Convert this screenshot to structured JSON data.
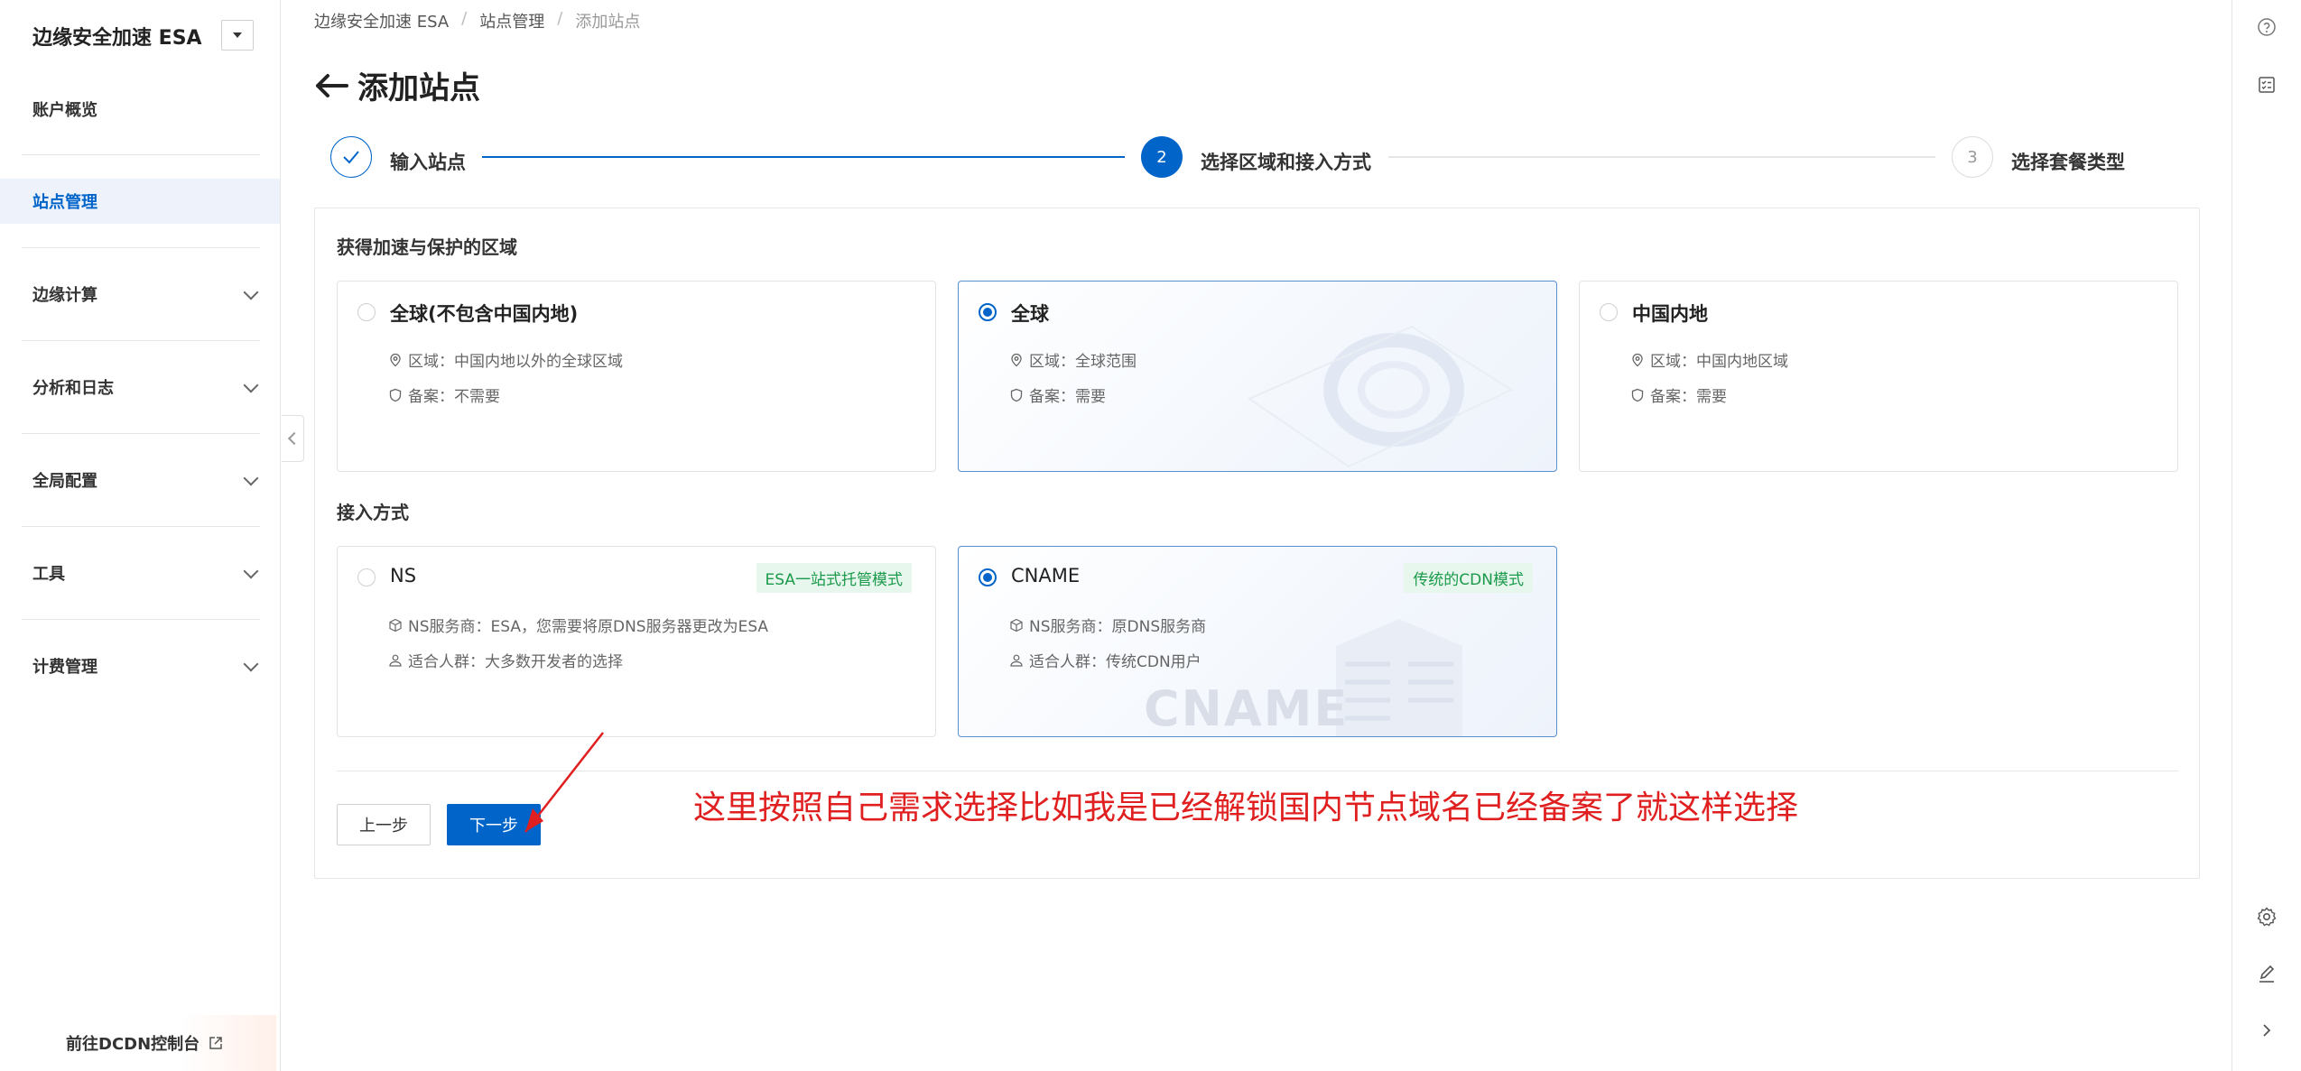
{
  "sidebar": {
    "brand": "边缘安全加速 ESA",
    "items": [
      {
        "label": "账户概览"
      },
      {
        "label": "站点管理"
      },
      {
        "label": "边缘计算"
      },
      {
        "label": "分析和日志"
      },
      {
        "label": "全局配置"
      },
      {
        "label": "工具"
      },
      {
        "label": "计费管理"
      }
    ],
    "footer_link": "前往DCDN控制台"
  },
  "breadcrumb": [
    "边缘安全加速 ESA",
    "站点管理",
    "添加站点"
  ],
  "page_title": "添加站点",
  "steps": [
    {
      "number": "",
      "label": "输入站点",
      "status": "done"
    },
    {
      "number": "2",
      "label": "选择区域和接入方式",
      "status": "active"
    },
    {
      "number": "3",
      "label": "选择套餐类型",
      "status": "pending"
    }
  ],
  "region": {
    "title": "获得加速与保护的区域",
    "options": [
      {
        "title": "全球(不包含中国内地)",
        "area": "区域：中国内地以外的全球区域",
        "icp": "备案：不需要"
      },
      {
        "title": "全球",
        "area": "区域：全球范围",
        "icp": "备案：需要"
      },
      {
        "title": "中国内地",
        "area": "区域：中国内地区域",
        "icp": "备案：需要"
      }
    ],
    "selected": 1
  },
  "access": {
    "title": "接入方式",
    "options": [
      {
        "title": "NS",
        "tag": "ESA一站式托管模式",
        "ns": "NS服务商：ESA，您需要将原DNS服务器更改为ESA",
        "audience": "适合人群：大多数开发者的选择"
      },
      {
        "title": "CNAME",
        "tag": "传统的CDN模式",
        "ns": "NS服务商：原DNS服务商",
        "audience": "适合人群：传统CDN用户",
        "watermark": "CNAME"
      }
    ],
    "selected": 1
  },
  "buttons": {
    "prev": "上一步",
    "next": "下一步"
  },
  "annotation": "这里按照自己需求选择比如我是已经解锁国内节点域名已经备案了就这样选择",
  "colors": {
    "primary": "#0064c8",
    "annotation": "#e02020",
    "tag_green": "#1a9a4a"
  }
}
